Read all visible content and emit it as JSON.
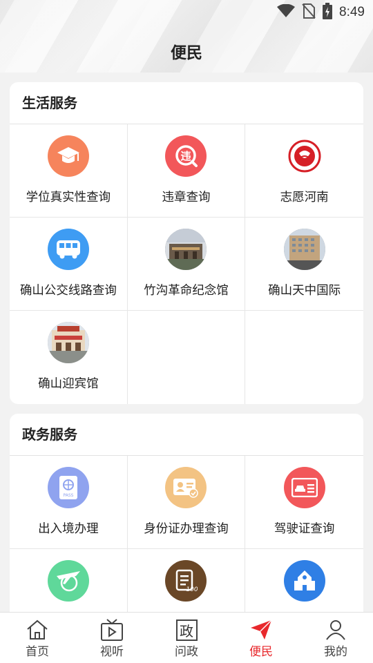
{
  "status": {
    "time": "8:49"
  },
  "header": {
    "title": "便民"
  },
  "life": {
    "title": "生活服务",
    "items": [
      {
        "label": "学位真实性查询",
        "icon": "graduation-cap-icon"
      },
      {
        "label": "违章查询",
        "icon": "traffic-violation-icon"
      },
      {
        "label": "志愿河南",
        "icon": "volunteer-logo-icon"
      },
      {
        "label": "确山公交线路查询",
        "icon": "bus-icon"
      },
      {
        "label": "竹沟革命纪念馆",
        "icon": "memorial-hall-photo"
      },
      {
        "label": "确山天中国际",
        "icon": "hotel-building-photo"
      },
      {
        "label": "确山迎宾馆",
        "icon": "guesthouse-photo"
      }
    ]
  },
  "gov": {
    "title": "政务服务",
    "items": [
      {
        "label": "出入境办理",
        "icon": "passport-icon"
      },
      {
        "label": "身份证办理查询",
        "icon": "id-card-icon"
      },
      {
        "label": "驾驶证查询",
        "icon": "driver-license-icon"
      },
      {
        "label": "",
        "icon": "airplane-globe-icon"
      },
      {
        "label": "",
        "icon": "exam-score-icon"
      },
      {
        "label": "",
        "icon": "school-icon"
      }
    ]
  },
  "tabs": [
    {
      "label": "首页",
      "icon": "home-icon"
    },
    {
      "label": "视听",
      "icon": "tv-play-icon"
    },
    {
      "label": "问政",
      "icon": "zheng-char-icon",
      "glyph": "政"
    },
    {
      "label": "便民",
      "icon": "paper-plane-icon",
      "active": true
    },
    {
      "label": "我的",
      "icon": "person-icon"
    }
  ],
  "colors": {
    "accent": "#e8282c",
    "orange": "#f6845c",
    "red": "#f2575a",
    "blue": "#3e9cf3",
    "periwinkle": "#8fa3ef",
    "amber": "#f3c383",
    "green": "#5fd89a",
    "brown": "#6a4727",
    "royal": "#2f7fe5"
  }
}
